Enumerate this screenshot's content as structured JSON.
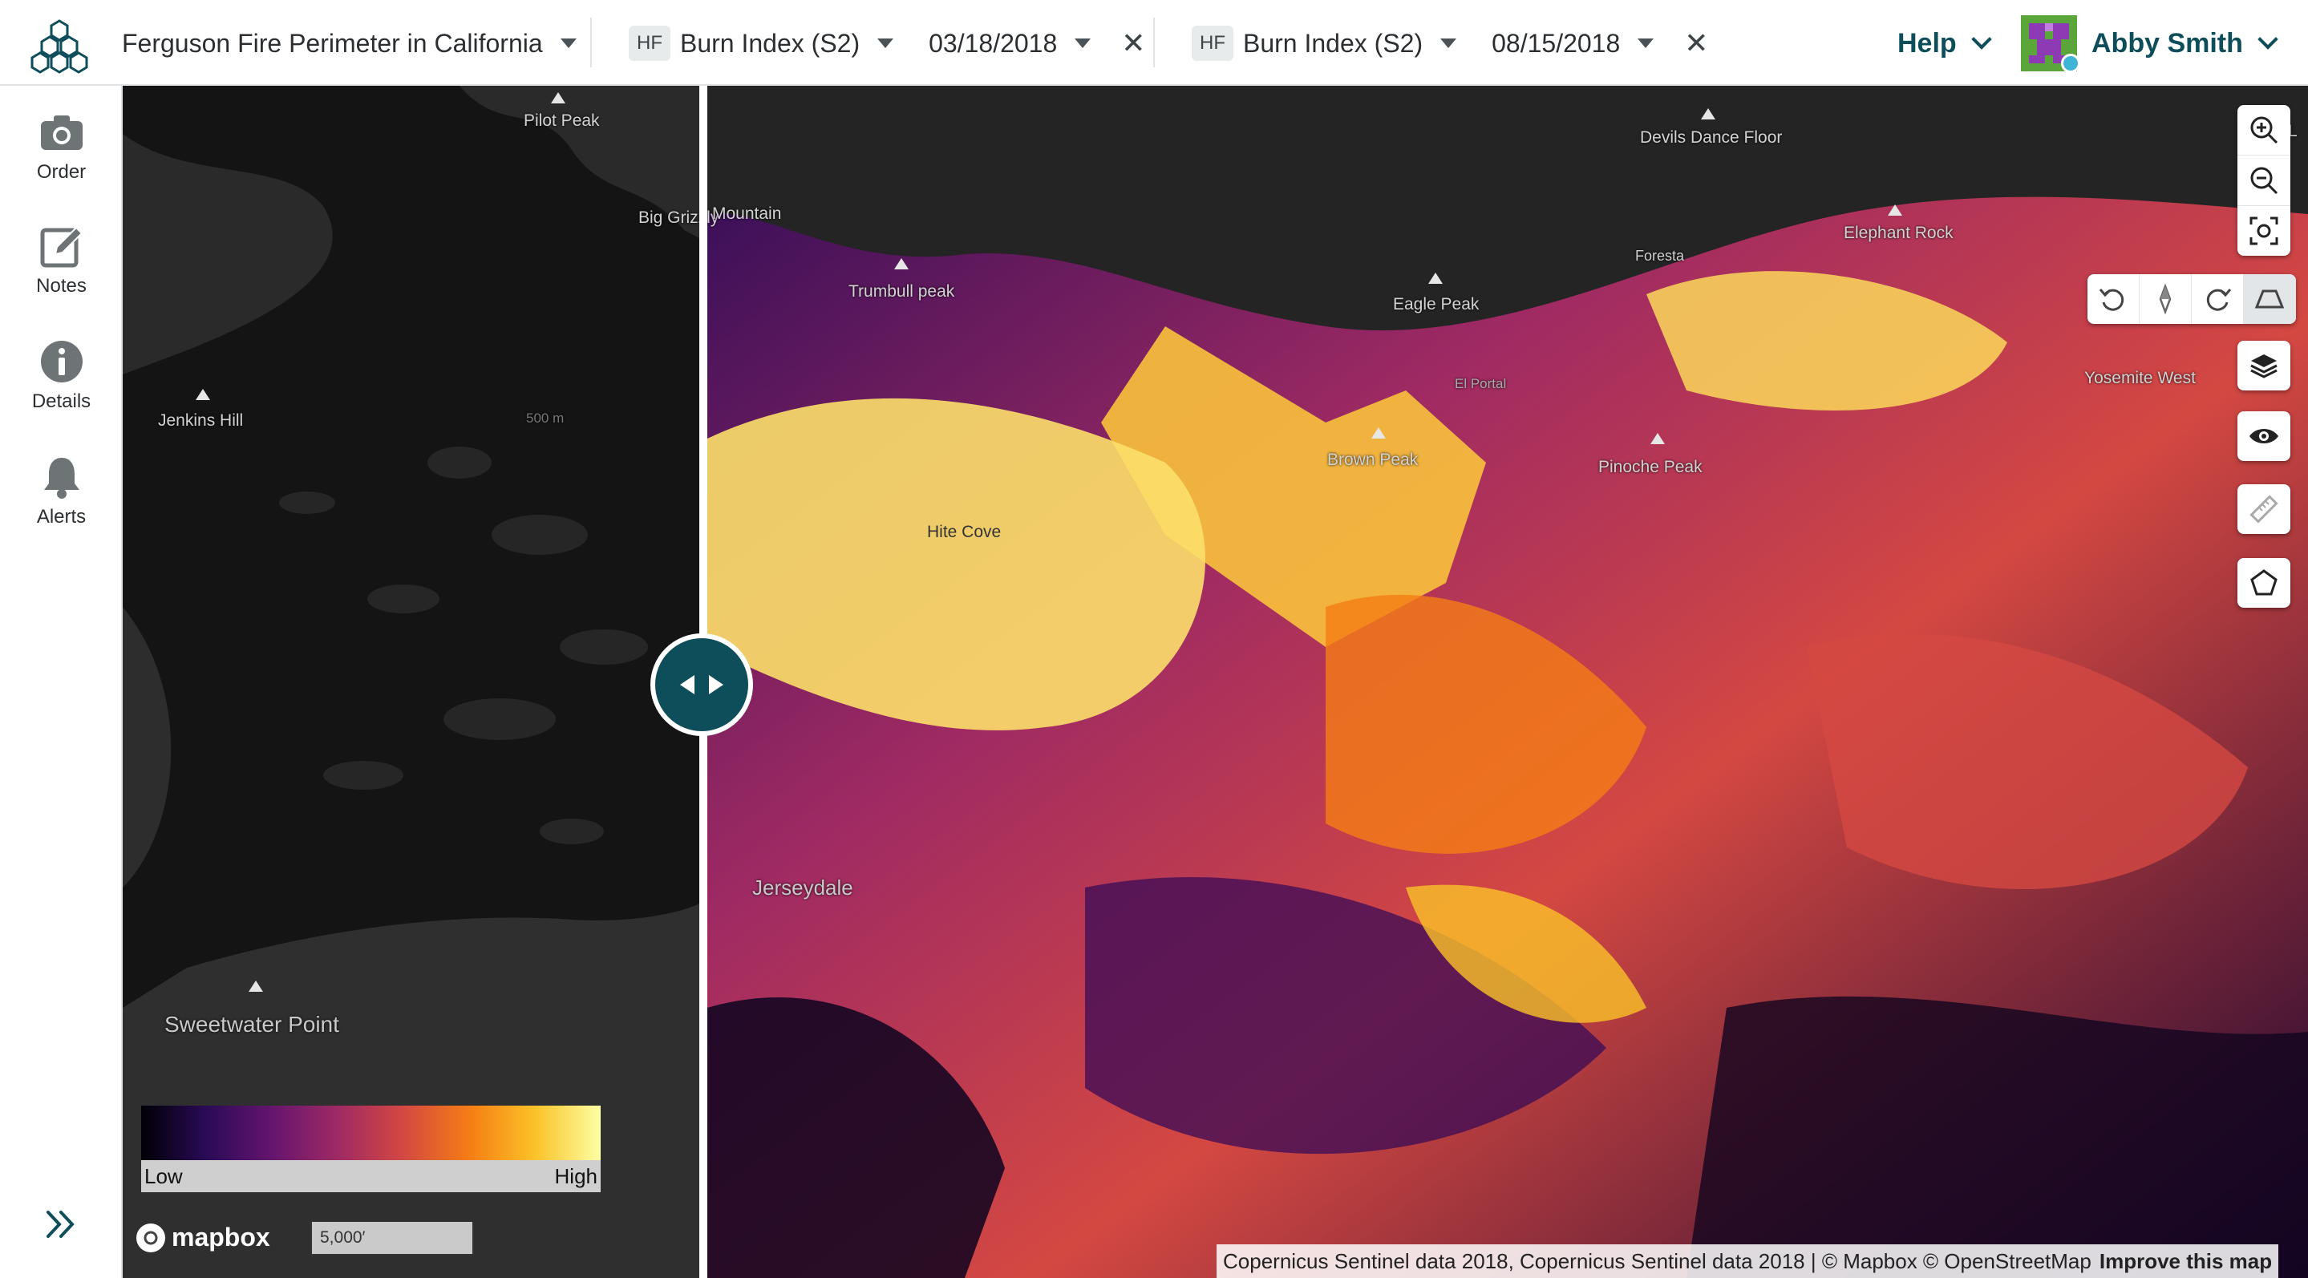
{
  "header": {
    "project_title": "Ferguson Fire Perimeter in California",
    "left_layer": {
      "badge": "HF",
      "name": "Burn Index (S2)",
      "date": "03/18/2018",
      "close": "✕"
    },
    "right_layer": {
      "badge": "HF",
      "name": "Burn Index (S2)",
      "date": "08/15/2018",
      "close": "✕"
    },
    "help_label": "Help",
    "user_name": "Abby Smith"
  },
  "sidebar": {
    "items": [
      {
        "label": "Order",
        "icon": "camera-icon"
      },
      {
        "label": "Notes",
        "icon": "edit-note-icon"
      },
      {
        "label": "Details",
        "icon": "info-icon"
      },
      {
        "label": "Alerts",
        "icon": "bell-icon"
      }
    ]
  },
  "map": {
    "left_labels": {
      "pilot_peak": "Pilot Peak",
      "big_grizzly": "Big Grizzly",
      "jenkins_hill": "Jenkins Hill",
      "sweetwater_point": "Sweetwater Point",
      "contour": "500 m"
    },
    "right_labels": {
      "big_grizzly_mountain": "Mountain",
      "trumbull_peak": "Trumbull peak",
      "devils_dance_floor": "Devils Dance Floor",
      "elephant_rock": "Elephant Rock",
      "foresta": "Foresta",
      "eagle_peak": "Eagle Peak",
      "el_portal": "El Portal",
      "yosemite_west": "Yosemite West",
      "brown_peak": "Brown Peak",
      "pinoche_peak": "Pinoche Peak",
      "hite_cove": "Hite Cove",
      "jerseydale": "Jerseydale",
      "edge": "L"
    },
    "legend": {
      "low": "Low",
      "high": "High"
    },
    "mapbox_text": "mapbox",
    "scale_text": "5,000′",
    "attribution": "Copernicus Sentinel data 2018, Copernicus Sentinel data 2018 | © Mapbox © OpenStreetMap",
    "improve_link": "Improve this map",
    "colors": {
      "accent": "#0e4e5b",
      "legend_low": "#000004",
      "legend_high": "#fcffa4"
    }
  }
}
